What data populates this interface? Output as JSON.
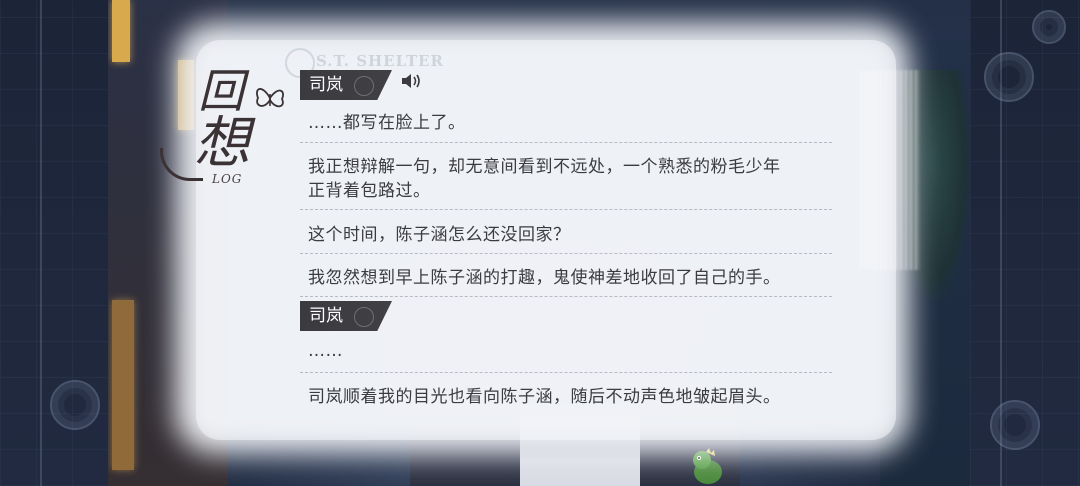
{
  "panel": {
    "title_line1": "回",
    "title_line2": "想",
    "title_sub": "LOG",
    "crest_text": "S.T. SHELTER"
  },
  "entries": [
    {
      "type": "speaker",
      "name": "司岚",
      "has_voice": true
    },
    {
      "type": "line",
      "text": "……都写在脸上了。"
    },
    {
      "type": "line",
      "text": "我正想辩解一句，却无意间看到不远处，一个熟悉的粉毛少年"
    },
    {
      "type": "line",
      "text": "正背着包路过。"
    },
    {
      "type": "line",
      "text": "这个时间，陈子涵怎么还没回家？"
    },
    {
      "type": "line",
      "text": "我忽然想到早上陈子涵的打趣，鬼使神差地收回了自己的手。"
    },
    {
      "type": "speaker",
      "name": "司岚",
      "has_voice": false
    },
    {
      "type": "line",
      "text": "……"
    },
    {
      "type": "line",
      "text": "司岚顺着我的目光也看向陈子涵，随后不动声色地皱起眉头。"
    }
  ],
  "colors": {
    "speaker_tag": "#3b3b3f",
    "text": "#3b3b40",
    "title": "#3a3234",
    "panel": "#f4f6fb",
    "background": "#1a2236",
    "window_light": "#d9a94e"
  },
  "icons": {
    "voice": "speaker-sound-icon",
    "decor": "butterfly-icon",
    "rose": "rose-ornament-icon"
  }
}
